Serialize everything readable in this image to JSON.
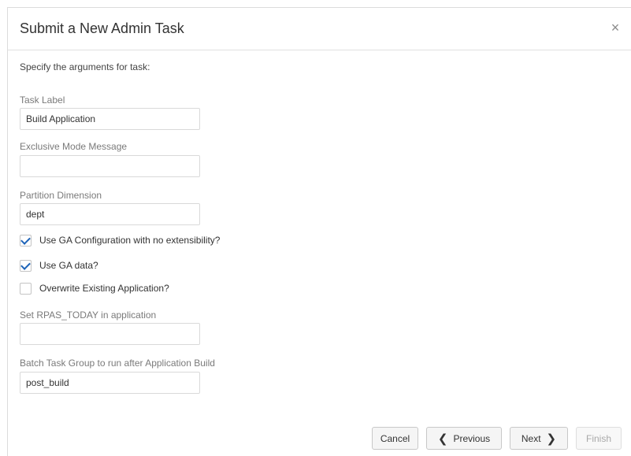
{
  "dialog": {
    "title": "Submit a New Admin Task",
    "close_glyph": "×",
    "instruction": "Specify the arguments for task:"
  },
  "fields": {
    "task_label": {
      "label": "Task Label",
      "value": "Build Application"
    },
    "exclusive_mode_message": {
      "label": "Exclusive Mode Message",
      "value": ""
    },
    "partition_dimension": {
      "label": "Partition Dimension",
      "value": "dept"
    },
    "rpas_today": {
      "label": "Set RPAS_TODAY in application",
      "value": ""
    },
    "batch_task_group": {
      "label": "Batch Task Group to run after Application Build",
      "value": "post_build"
    }
  },
  "checkboxes": {
    "ga_config": {
      "label": "Use GA Configuration with no extensibility?",
      "checked": true
    },
    "ga_data": {
      "label": "Use GA data?",
      "checked": true
    },
    "overwrite": {
      "label": "Overwrite Existing Application?",
      "checked": false
    }
  },
  "footer": {
    "cancel": "Cancel",
    "previous": "Previous",
    "next": "Next",
    "finish": "Finish"
  },
  "icons": {
    "close": "close-icon",
    "previous": "chevron-left-icon",
    "next": "chevron-right-icon",
    "check": "checkmark-icon"
  },
  "colors": {
    "check_accent": "#1d63b8",
    "border": "#d9d9d9"
  }
}
